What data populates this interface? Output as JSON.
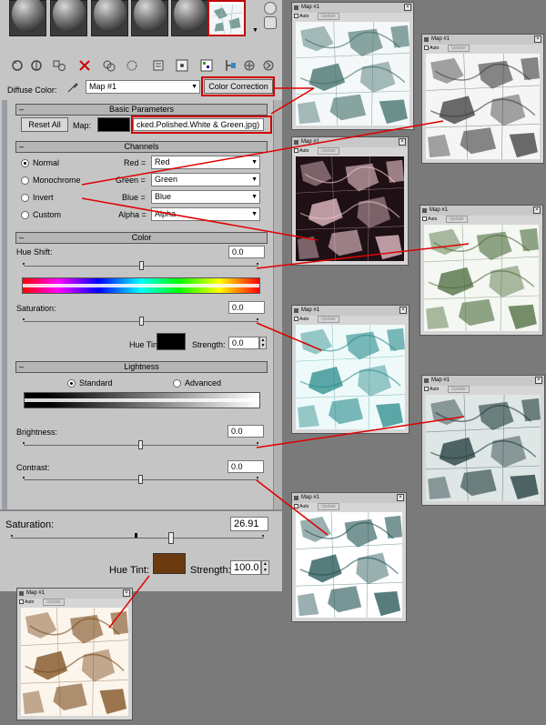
{
  "colors": {
    "highlight": "#d00000",
    "hue_tint_default": "#000000",
    "hue_tint_brown": "#6b3a10",
    "panel_bg": "#c5c5c5",
    "desktop_bg": "#7a7a7a"
  },
  "toolbar": {
    "icons": [
      "get-material-icon",
      "put-material-icon",
      "assign-material-icon",
      "reset-icon",
      "copy-material-icon",
      "unique-icon",
      "put-to-library-icon",
      "material-id-icon",
      "show-map-icon",
      "show-end-result-icon",
      "go-to-parent-icon",
      "go-forward-icon"
    ]
  },
  "material": {
    "diffuse_label": "Diffuse Color:",
    "map_name": "Map #1",
    "map_type": "Color Correction"
  },
  "basic": {
    "title": "Basic Parameters",
    "reset_label": "Reset All",
    "map_label": "Map:",
    "map_file": "cked.Polished.White & Green.jpg)"
  },
  "channels": {
    "title": "Channels",
    "options": [
      "Normal",
      "Monochrome",
      "Invert",
      "Custom"
    ],
    "selected": "Normal",
    "rows": [
      {
        "label": "Red =",
        "value": "Red"
      },
      {
        "label": "Green =",
        "value": "Green"
      },
      {
        "label": "Blue =",
        "value": "Blue"
      },
      {
        "label": "Alpha =",
        "value": "Alpha"
      }
    ]
  },
  "color": {
    "title": "Color",
    "hue_shift_label": "Hue Shift:",
    "hue_shift_value": "0.0",
    "saturation_label": "Saturation:",
    "saturation_value": "0.0",
    "hue_tint_label": "Hue Tint:",
    "strength_label": "Strength:",
    "strength_value": "0.0"
  },
  "lightness": {
    "title": "Lightness",
    "standard_label": "Standard",
    "advanced_label": "Advanced",
    "selected": "Standard",
    "brightness_label": "Brightness:",
    "brightness_value": "0.0",
    "contrast_label": "Contrast:",
    "contrast_value": "0.0"
  },
  "zoomed": {
    "saturation_label": "Saturation:",
    "saturation_value": "26.91",
    "saturation_level": 26.91,
    "hue_tint_label": "Hue Tint:",
    "strength_label": "Strength:",
    "strength_value": "100.0"
  },
  "map_windows": {
    "title": "Map #1",
    "auto_label": "Auto",
    "update_label": "Update",
    "items": [
      {
        "id": "original",
        "tone": "#3d6d68",
        "bg": "#f4f8f8"
      },
      {
        "id": "monochrome",
        "tone": "#3a3a3a",
        "bg": "#f5f5f5"
      },
      {
        "id": "invert",
        "tone": "#f0c8d0",
        "bg": "#1e1014"
      },
      {
        "id": "hue-shift",
        "tone": "#4a6a3a",
        "bg": "#f4f7f2"
      },
      {
        "id": "saturation",
        "tone": "#2a8a8a",
        "bg": "#eefafa"
      },
      {
        "id": "brightness",
        "tone": "#1e3838",
        "bg": "#dfe6e6"
      },
      {
        "id": "contrast",
        "tone": "#1e5050",
        "bg": "#ffffff"
      },
      {
        "id": "hue-tint",
        "tone": "#7a4a1a",
        "bg": "#fbf5ec"
      }
    ]
  }
}
